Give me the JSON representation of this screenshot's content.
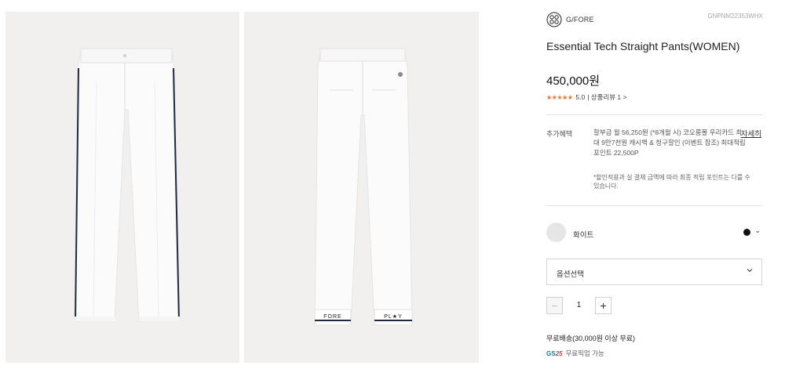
{
  "gallery": {
    "front_alt": "front view",
    "back_alt": "back view",
    "hem_left_text": "FORE",
    "hem_right_text": "PL★Y"
  },
  "product": {
    "brand": "G/FORE",
    "code": "GNPNM22353WHX",
    "title": "Essential Tech Straight Pants(WOMEN)",
    "price": "450,000원",
    "rating_stars": "★★★★★",
    "rating_score": "5.0",
    "review_link": "| 상품리뷰 1 >"
  },
  "benefits": {
    "label": "추가혜택",
    "detail_link": "자세히",
    "text": "할부금 월 56,250원 (*8개월 시) 코오롱몰 우리카드 최대 9만7천원 캐시백 & 청구할인 (이벤트 참조) 최대적립포인트 22,500P",
    "note": "*할인적용과 실 결제 금액에 따라 최종 적립 포인트는 다를 수 있습니다."
  },
  "color": {
    "name": "화이트",
    "swatch_color": "#e6e6e6",
    "alt_dot_color": "#111111",
    "chevron": "⌄"
  },
  "option": {
    "label": "옵션선택"
  },
  "quantity": {
    "minus": "−",
    "value": "1",
    "plus": "+"
  },
  "shipping": {
    "text": "무료배송(30,000원 이상 무료)",
    "gs_logo_prefix": "GS",
    "gs_logo_num": "25",
    "gs_text": "무료픽업 가능"
  }
}
